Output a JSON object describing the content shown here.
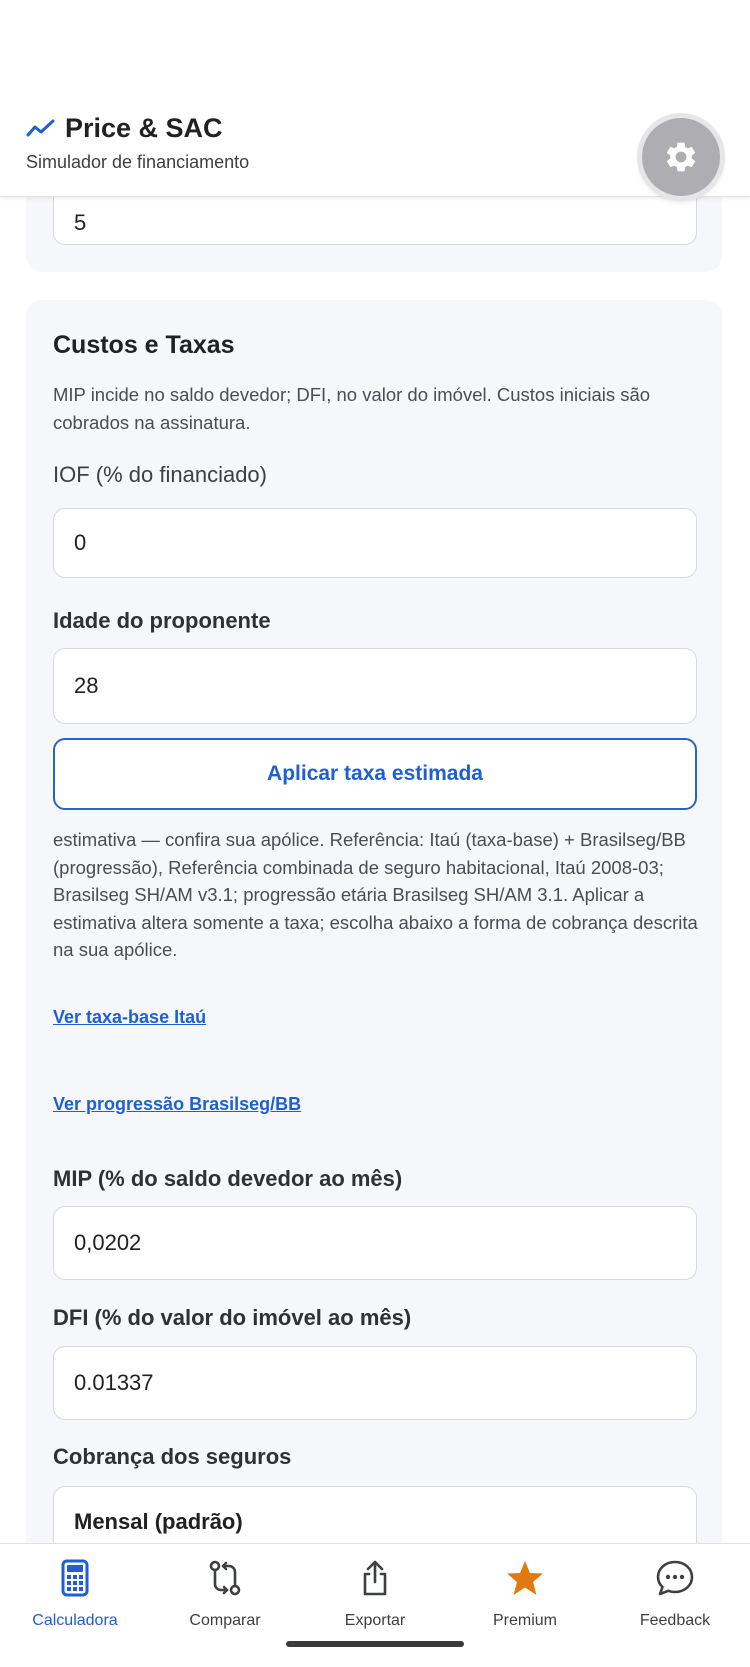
{
  "header": {
    "title": "Price & SAC",
    "subtitle": "Simulador de financiamento"
  },
  "top_card": {
    "value": "5"
  },
  "costs": {
    "title": "Custos e Taxas",
    "description": "MIP incide no saldo devedor; DFI, no valor do imóvel. Custos iniciais são cobrados na assinatura.",
    "iof_label": "IOF (% do financiado)",
    "iof_value": "0",
    "age_label": "Idade do proponente",
    "age_value": "28",
    "apply_button": "Aplicar taxa estimada",
    "estimate_note": "estimativa — confira sua apólice. Referência: Itaú (taxa-base) + Brasilseg/BB (progressão), Referência combinada de seguro habitacional, Itaú 2008-03; Brasilseg SH/AM v3.1; progressão etária Brasilseg SH/AM 3.1. Aplicar a estimativa altera somente a taxa; escolha abaixo a forma de cobrança descrita na sua apólice.",
    "link_itau": "Ver taxa-base Itaú",
    "link_brasilseg": "Ver progressão Brasilseg/BB",
    "mip_label": "MIP (% do saldo devedor ao mês)",
    "mip_value": "0,0202",
    "dfi_label": "DFI (% do valor do imóvel ao mês)",
    "dfi_value": "0.01337",
    "charge_label": "Cobrança dos seguros",
    "charge_value": "Mensal (padrão)"
  },
  "nav": {
    "items": [
      {
        "label": "Calculadora",
        "icon": "calculator-icon",
        "active": true
      },
      {
        "label": "Comparar",
        "icon": "compare-icon",
        "active": false
      },
      {
        "label": "Exportar",
        "icon": "share-icon",
        "active": false
      },
      {
        "label": "Premium",
        "icon": "star-icon",
        "active": false
      },
      {
        "label": "Feedback",
        "icon": "chat-bubble-icon",
        "active": false
      }
    ]
  },
  "colors": {
    "accent": "#1f5fd1",
    "premium": "#e07a10",
    "card_bg": "#f6f7fa",
    "settings_bg": "#aeaeb2"
  }
}
